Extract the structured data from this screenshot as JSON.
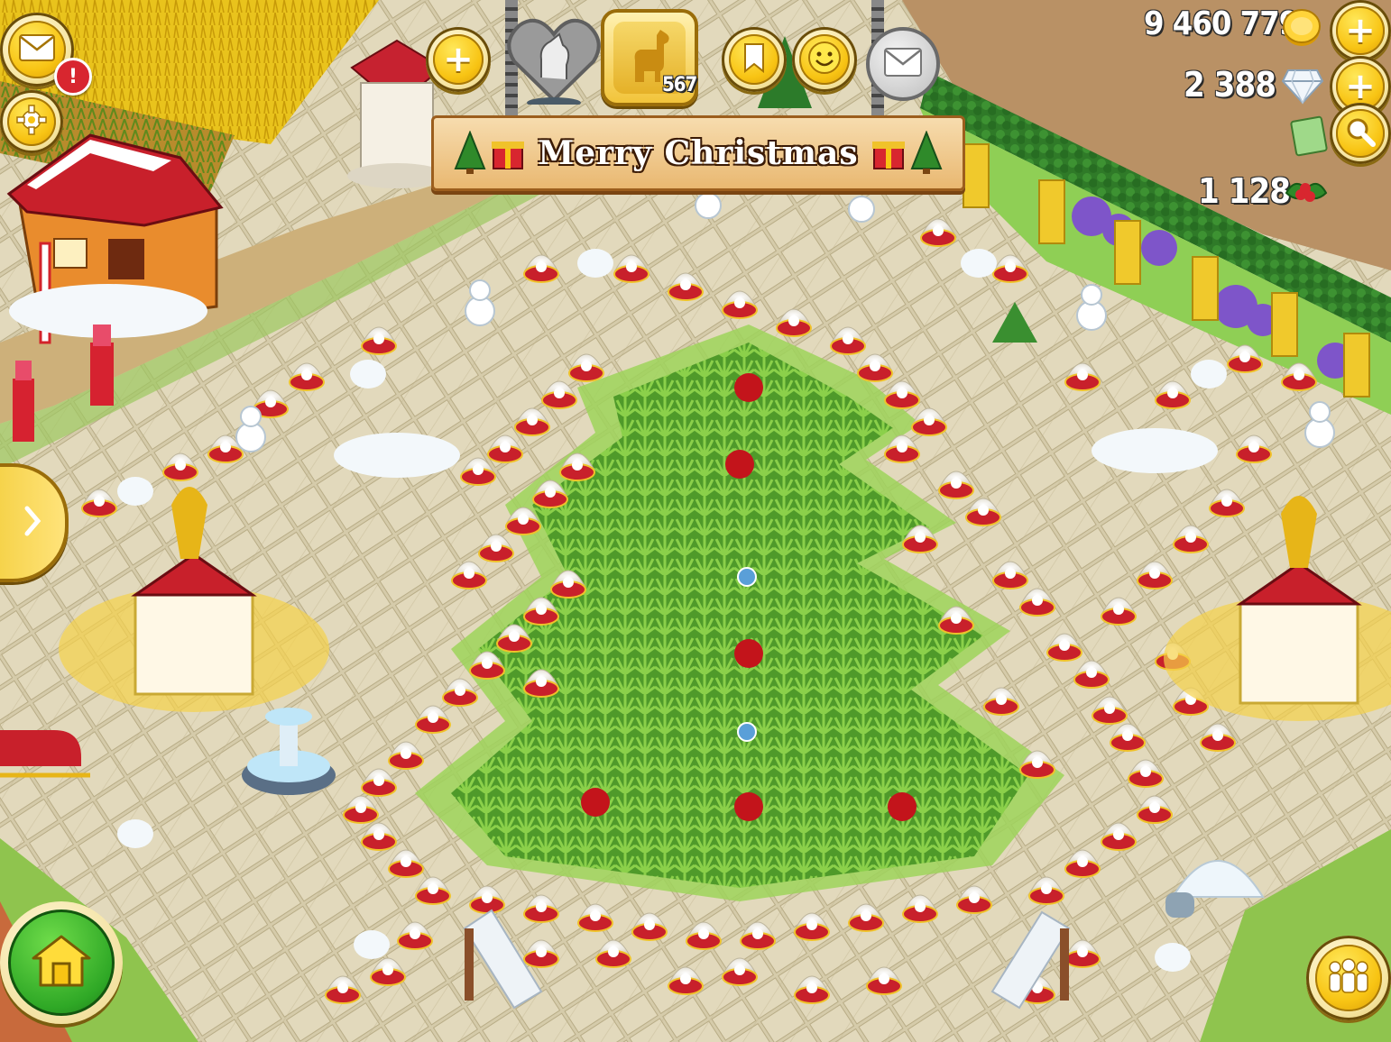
{
  "hud": {
    "coins": "9 460 779",
    "diamonds": "2 388",
    "holiday_currency": "1 128",
    "level": "567",
    "banner_text": "Merry Christmas",
    "notification_badge": "!",
    "plus": "+"
  },
  "icons": {
    "mail": "envelope-icon",
    "settings": "gear-icon",
    "add": "plus-icon",
    "horse": "horse-heart-icon",
    "llama": "llama-icon",
    "bookmark": "bookmark-icon",
    "friends": "smiley-icon",
    "messages": "envelope-icon",
    "coin": "coin-icon",
    "diamond": "diamond-icon",
    "holly": "holly-icon",
    "search": "magnifier-icon",
    "home": "house-icon",
    "side_expand": "chevron-right-icon",
    "neighbors": "people-icon",
    "tickets": "ticket-icon"
  },
  "colors": {
    "gold": "#f8c414",
    "grass": "#7cc142",
    "paving": "#d2c8a6",
    "banner": "#e9b871",
    "home_button": "#2fa826"
  }
}
